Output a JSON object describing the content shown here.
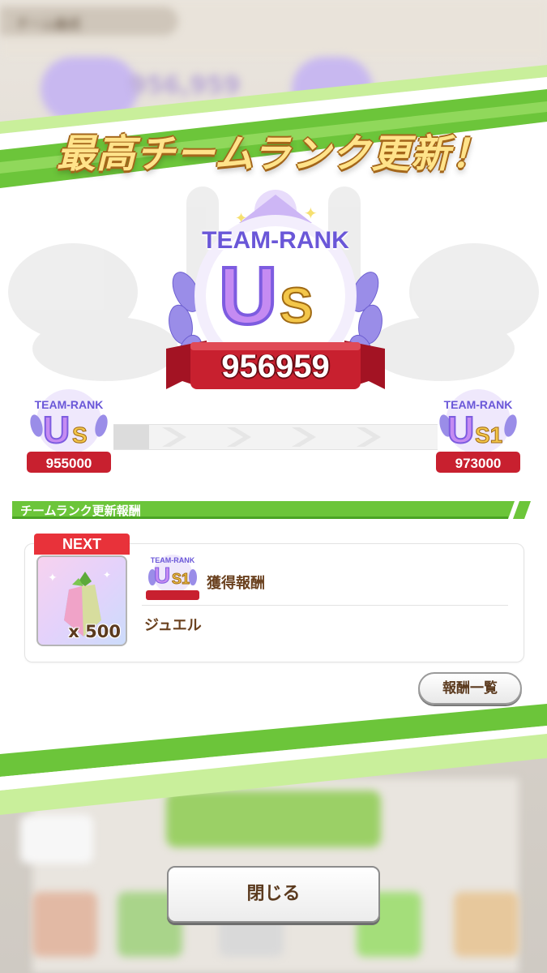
{
  "background": {
    "tab_label": "チーム編成",
    "rank_number": "956,959"
  },
  "headline": "最高チームランク更新！",
  "current_rank": {
    "label": "TEAM-RANK",
    "rank_main": "U",
    "rank_sub": "S",
    "score": "956959"
  },
  "progress": {
    "left": {
      "label": "TEAM-RANK",
      "rank_main": "U",
      "rank_sub": "S",
      "score": "955000"
    },
    "right": {
      "label": "TEAM-RANK",
      "rank_main": "U",
      "rank_sub": "S1",
      "score": "973000"
    },
    "fill_fraction": 0.11
  },
  "reward_section": {
    "title": "チームランク更新報酬",
    "next_badge": "NEXT",
    "rank_badge": {
      "label": "TEAM-RANK",
      "rank_main": "U",
      "rank_sub": "S1"
    },
    "reward_label": "獲得報酬",
    "item_name": "ジュエル",
    "item_quantity": "x 500"
  },
  "buttons": {
    "reward_list": "報酬一覧",
    "close": "閉じる"
  },
  "colors": {
    "accent_green": "#6cc53a",
    "light_green": "#c9ef9b",
    "ribbon_red": "#c8202f",
    "brown_text": "#6b4220",
    "next_red": "#e8323a"
  }
}
